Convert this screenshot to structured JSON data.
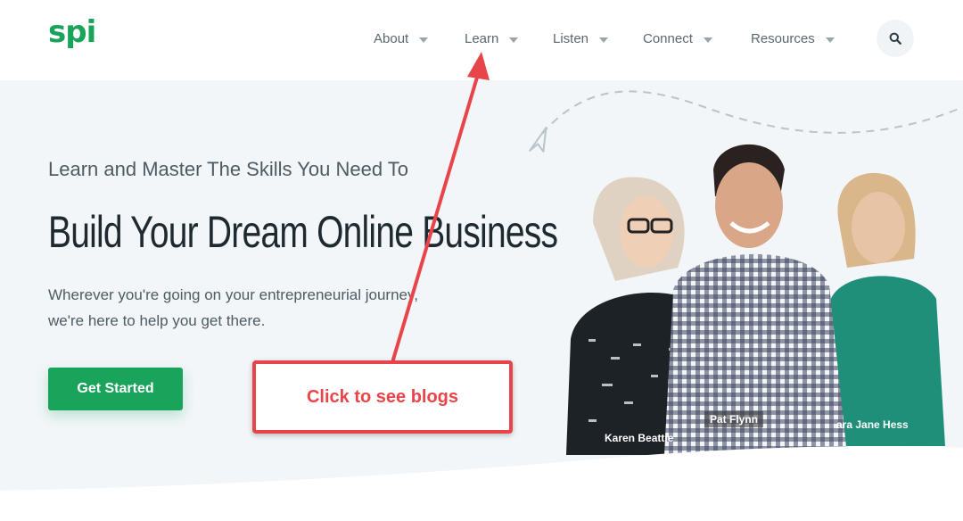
{
  "logo": {
    "text": "spi"
  },
  "nav": [
    {
      "label": "About"
    },
    {
      "label": "Learn"
    },
    {
      "label": "Listen"
    },
    {
      "label": "Connect"
    },
    {
      "label": "Resources"
    }
  ],
  "search": {
    "icon": "search-icon"
  },
  "hero": {
    "kicker": "Learn and Master The Skills You Need To",
    "headline": "Build Your Dream Online Business",
    "subtext": "Wherever you're going on your entrepreneurial journey, we're here to help you get there.",
    "cta_label": "Get Started"
  },
  "people": [
    {
      "name": "Karen Beattie"
    },
    {
      "name": "Pat Flynn"
    },
    {
      "name": "ara Jane Hess"
    }
  ],
  "annotation": {
    "text": "Click to see blogs"
  },
  "colors": {
    "brand": "#1aa35a",
    "annotation": "#e8454a",
    "hero_bg": "#f2f6f8",
    "text": "#1f2a30"
  }
}
